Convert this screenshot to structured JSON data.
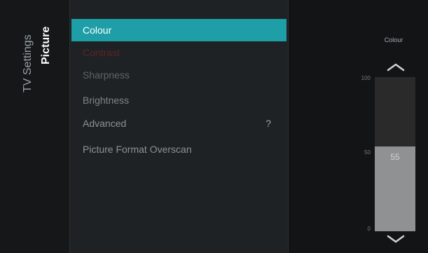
{
  "breadcrumb": {
    "parent": "TV Settings",
    "current": "Picture"
  },
  "menu": {
    "items": [
      {
        "label": "Colour",
        "selected": true
      },
      {
        "label": "Contrast"
      },
      {
        "label": "Sharpness"
      },
      {
        "label": "Brightness"
      },
      {
        "label": "Advanced",
        "hint": "?"
      },
      {
        "label": "Picture Format Overscan"
      }
    ]
  },
  "slider": {
    "title": "Colour",
    "value": 55,
    "value_label": "55",
    "min": 0,
    "max": 100,
    "tick_max": "100",
    "tick_mid": "50",
    "tick_min": "0"
  },
  "colors": {
    "accent": "#1e9ea7",
    "background": "#121416",
    "panel": "#1f2224"
  },
  "icons": {
    "up": "chevron-up-icon",
    "down": "chevron-down-icon"
  }
}
